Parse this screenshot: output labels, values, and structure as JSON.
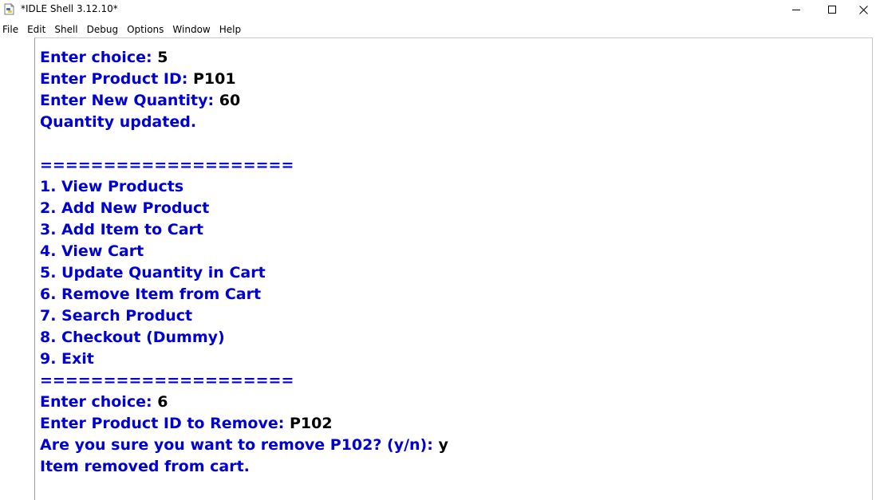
{
  "window": {
    "title": "*IDLE Shell 3.12.10*",
    "icon": "python-idle-icon",
    "controls": {
      "minimize_glyph": "—",
      "maximize_glyph": "☐",
      "close_glyph": "✕"
    }
  },
  "menu": [
    "File",
    "Edit",
    "Shell",
    "Debug",
    "Options",
    "Window",
    "Help"
  ],
  "colors": {
    "output_text": "#0000d6",
    "user_input": "#000000",
    "background": "#ffffff"
  },
  "shell_lines": [
    {
      "prompt": "Enter choice: ",
      "input": "5"
    },
    {
      "prompt": "Enter Product ID: ",
      "input": "P101"
    },
    {
      "prompt": "Enter New Quantity: ",
      "input": "60"
    },
    {
      "prompt": "Quantity updated.",
      "input": ""
    },
    {
      "prompt": "",
      "input": ""
    },
    {
      "prompt": "====================",
      "input": ""
    },
    {
      "prompt": "1. View Products",
      "input": ""
    },
    {
      "prompt": "2. Add New Product",
      "input": ""
    },
    {
      "prompt": "3. Add Item to Cart",
      "input": ""
    },
    {
      "prompt": "4. View Cart",
      "input": ""
    },
    {
      "prompt": "5. Update Quantity in Cart",
      "input": ""
    },
    {
      "prompt": "6. Remove Item from Cart",
      "input": ""
    },
    {
      "prompt": "7. Search Product",
      "input": ""
    },
    {
      "prompt": "8. Checkout (Dummy)",
      "input": ""
    },
    {
      "prompt": "9. Exit",
      "input": ""
    },
    {
      "prompt": "====================",
      "input": ""
    },
    {
      "prompt": "Enter choice: ",
      "input": "6"
    },
    {
      "prompt": "Enter Product ID to Remove: ",
      "input": "P102"
    },
    {
      "prompt": "Are you sure you want to remove P102? (y/n): ",
      "input": "y"
    },
    {
      "prompt": "Item removed from cart.",
      "input": ""
    }
  ]
}
